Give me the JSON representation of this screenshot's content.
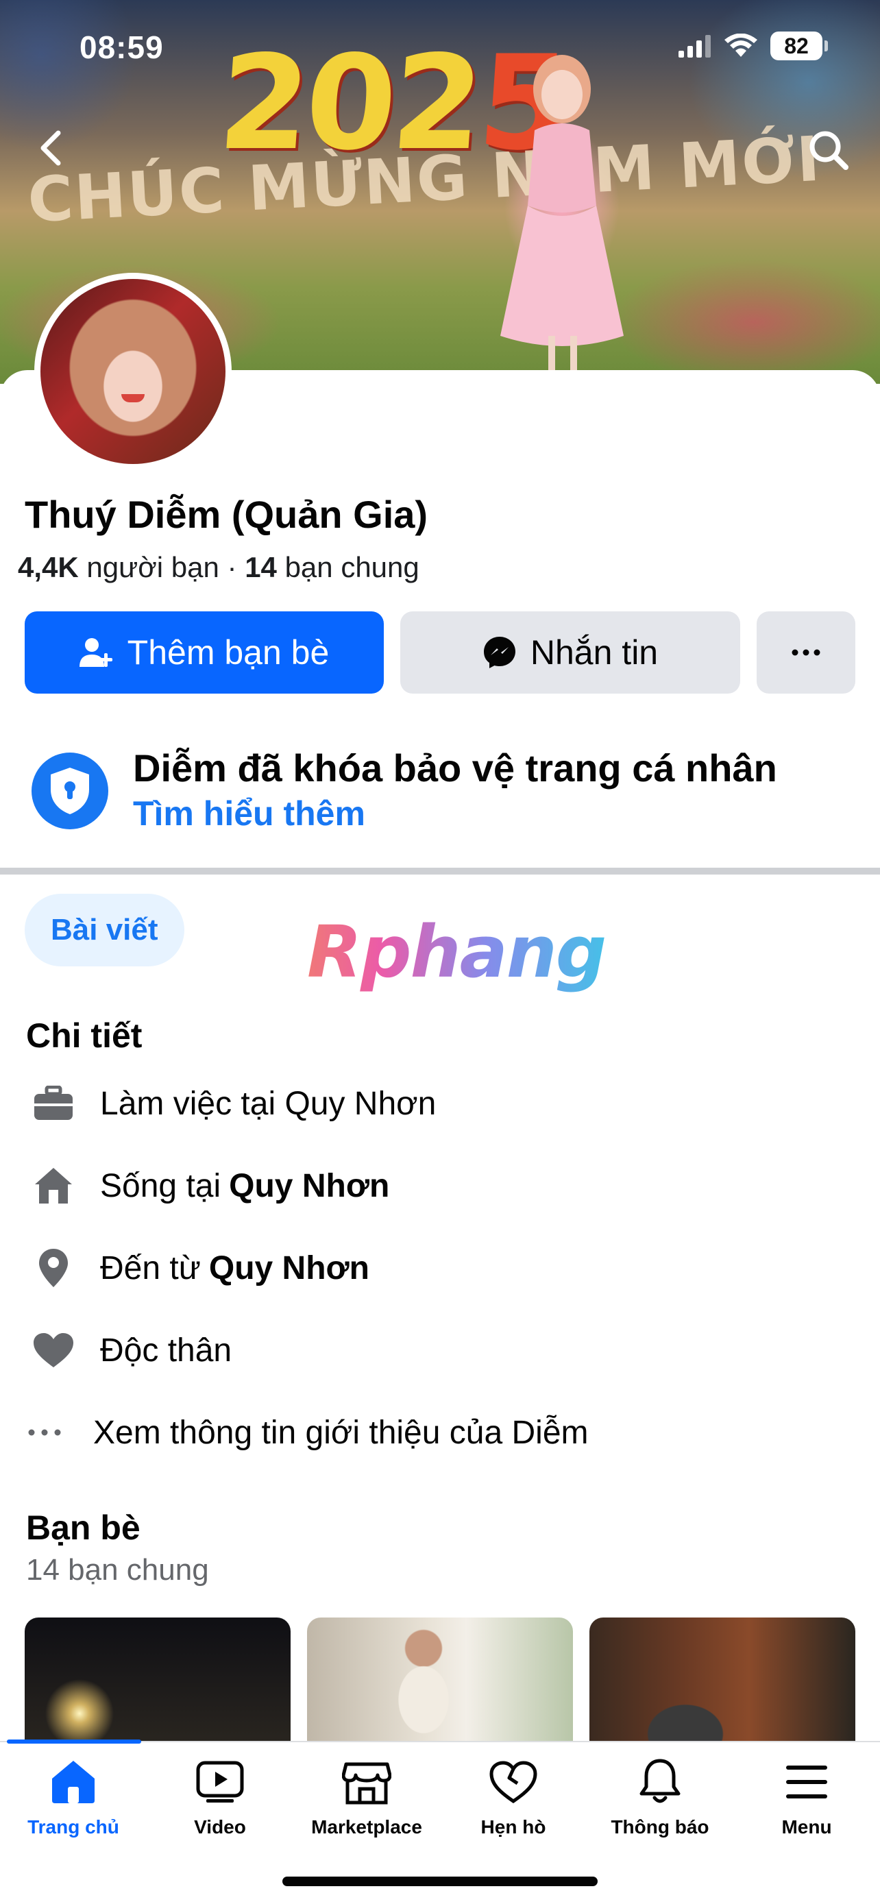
{
  "status_bar": {
    "time": "08:59",
    "battery": "82"
  },
  "cover": {
    "year_part1": "202",
    "year_part2": "5",
    "slogan": "CHÚC MỪNG NĂM MỚI"
  },
  "profile": {
    "name": "Thuý Diễm (Quản Gia)",
    "friends_count": "4,4K",
    "friends_word": "người bạn",
    "separator": "·",
    "mutual_count": "14",
    "mutual_word": "bạn chung"
  },
  "actions": {
    "add_friend": "Thêm bạn bè",
    "message": "Nhắn tin",
    "more": "···"
  },
  "lock_notice": {
    "title": "Diễm đã khóa bảo vệ trang cá nhân",
    "link": "Tìm hiểu thêm"
  },
  "tabs": {
    "posts": "Bài viết"
  },
  "watermark": "Rphang",
  "details": {
    "title": "Chi tiết",
    "items": [
      {
        "icon": "briefcase-icon",
        "text": "Làm việc tại Quy Nhơn",
        "bold": ""
      },
      {
        "icon": "home-icon",
        "text": "Sống tại",
        "bold": "Quy Nhơn"
      },
      {
        "icon": "location-pin-icon",
        "text": "Đến từ",
        "bold": "Quy Nhơn"
      },
      {
        "icon": "heart-icon",
        "text": "Độc thân",
        "bold": ""
      }
    ],
    "see_more": "Xem thông tin giới thiệu của Diễm"
  },
  "friends": {
    "title": "Bạn bè",
    "subtitle": "14 bạn chung"
  },
  "bottom_nav": [
    {
      "icon": "home-icon",
      "label": "Trang chủ",
      "active": true
    },
    {
      "icon": "video-icon",
      "label": "Video",
      "active": false
    },
    {
      "icon": "marketplace-icon",
      "label": "Marketplace",
      "active": false
    },
    {
      "icon": "dating-heart-icon",
      "label": "Hẹn hò",
      "active": false
    },
    {
      "icon": "bell-icon",
      "label": "Thông báo",
      "active": false
    },
    {
      "icon": "menu-icon",
      "label": "Menu",
      "active": false
    }
  ],
  "colors": {
    "accent": "#0866ff",
    "link": "#1877f2",
    "chip_bg": "#e7f3ff",
    "secondary_btn": "#e4e6eb"
  }
}
